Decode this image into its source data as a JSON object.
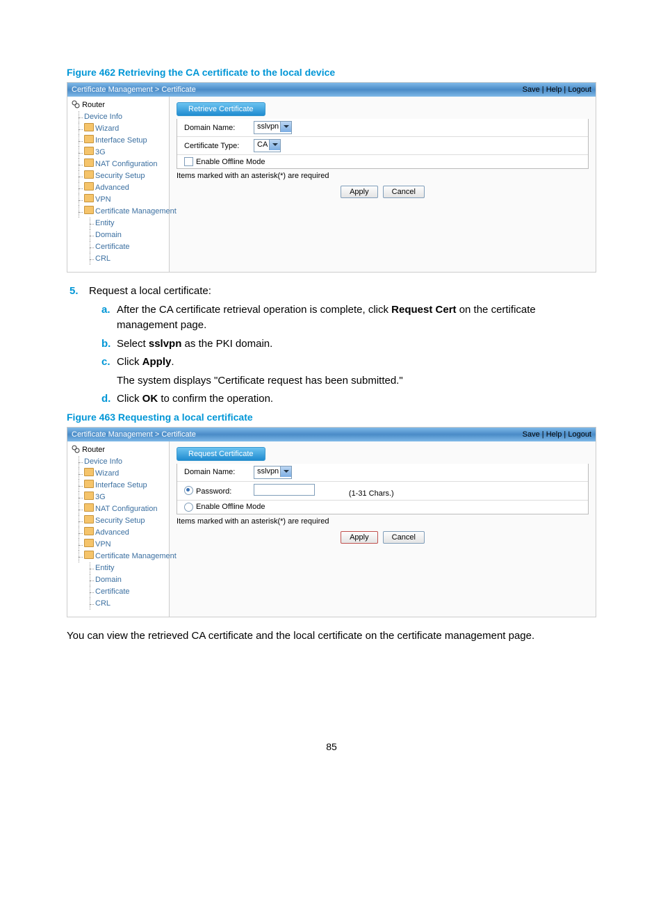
{
  "figure462": {
    "caption": "Figure 462 Retrieving the CA certificate to the local device",
    "breadcrumb": "Certificate Management > Certificate",
    "links": {
      "save": "Save",
      "help": "Help",
      "logout": "Logout"
    },
    "tree": {
      "root": "Router",
      "items": [
        "Device Info",
        "Wizard",
        "Interface Setup",
        "3G",
        "NAT Configuration",
        "Security Setup",
        "Advanced",
        "VPN",
        "Certificate Management"
      ],
      "sub": [
        "Entity",
        "Domain",
        "Certificate",
        "CRL"
      ]
    },
    "tab": "Retrieve Certificate",
    "domain_label": "Domain Name:",
    "domain_value": "sslvpn",
    "cert_type_label": "Certificate Type:",
    "cert_type_value": "CA",
    "offline_label": "Enable Offline Mode",
    "note": "Items marked with an asterisk(*) are required",
    "apply": "Apply",
    "cancel": "Cancel"
  },
  "step5": {
    "num": "5.",
    "title": "Request a local certificate:",
    "a": {
      "letter": "a.",
      "pre": "After the CA certificate retrieval operation is complete, click ",
      "bold": "Request Cert",
      "post": " on the certificate management page."
    },
    "b": {
      "letter": "b.",
      "pre": "Select ",
      "bold": "sslvpn",
      "post": " as the PKI domain."
    },
    "c": {
      "letter": "c.",
      "pre": "Click ",
      "bold": "Apply",
      "post": ".",
      "note": "The system displays \"Certificate request has been submitted.\""
    },
    "d": {
      "letter": "d.",
      "pre": "Click ",
      "bold": "OK",
      "post": " to confirm the operation."
    }
  },
  "figure463": {
    "caption": "Figure 463 Requesting a local certificate",
    "breadcrumb": "Certificate Management > Certificate",
    "links": {
      "save": "Save",
      "help": "Help",
      "logout": "Logout"
    },
    "tree": {
      "root": "Router",
      "items": [
        "Device Info",
        "Wizard",
        "Interface Setup",
        "3G",
        "NAT Configuration",
        "Security Setup",
        "Advanced",
        "VPN",
        "Certificate Management"
      ],
      "sub": [
        "Entity",
        "Domain",
        "Certificate",
        "CRL"
      ]
    },
    "tab": "Request Certificate",
    "domain_label": "Domain Name:",
    "domain_value": "sslvpn",
    "password_label": "Password:",
    "password_hint": "(1-31 Chars.)",
    "offline_label": "Enable Offline Mode",
    "note": "Items marked with an asterisk(*) are required",
    "apply": "Apply",
    "cancel": "Cancel"
  },
  "closing_para": "You can view the retrieved CA certificate and the local certificate on the certificate management page.",
  "page_number": "85"
}
